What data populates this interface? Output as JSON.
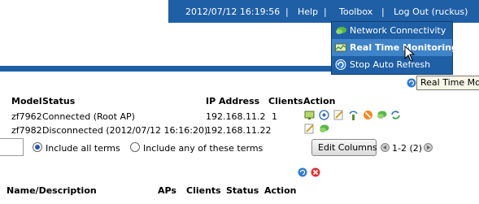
{
  "topbar": {
    "datetime": "2012/07/12 16:19:56",
    "help": "Help",
    "toolbox": "Toolbox",
    "logout": "Log Out (ruckus)",
    "separator": "|"
  },
  "toolbox_menu": {
    "items": [
      {
        "label": "Network Connectivity",
        "icon": "network-icon"
      },
      {
        "label": "Real Time Monitoring",
        "icon": "monitor-icon"
      },
      {
        "label": "Stop Auto Refresh",
        "icon": "refresh-icon"
      }
    ]
  },
  "tooltip": {
    "text": "Real Time Mo"
  },
  "ap_table": {
    "columns": [
      "Model",
      "Status",
      "IP Address",
      "Clients",
      "Action"
    ],
    "rows": [
      {
        "model": "zf7962",
        "status": "Connected (Root AP)",
        "ip": "192.168.11.2",
        "clients": "1"
      },
      {
        "model": "zf7982",
        "status": "Disconnected (2012/07/12 16:16:20)",
        "ip": "192.168.11.22",
        "clients": ""
      }
    ]
  },
  "search": {
    "option_all": "Include all terms",
    "option_any": "Include any of these terms",
    "selected": "Include all terms"
  },
  "edit_columns": "Edit Columns",
  "pagination": {
    "text": "1-2 (2)"
  },
  "wlan_table": {
    "columns": [
      "Name/Description",
      "APs",
      "Clients",
      "Status",
      "Action"
    ]
  },
  "colors": {
    "topbar": "#1f5fa6",
    "menu_highlight": "#3f83c9"
  }
}
